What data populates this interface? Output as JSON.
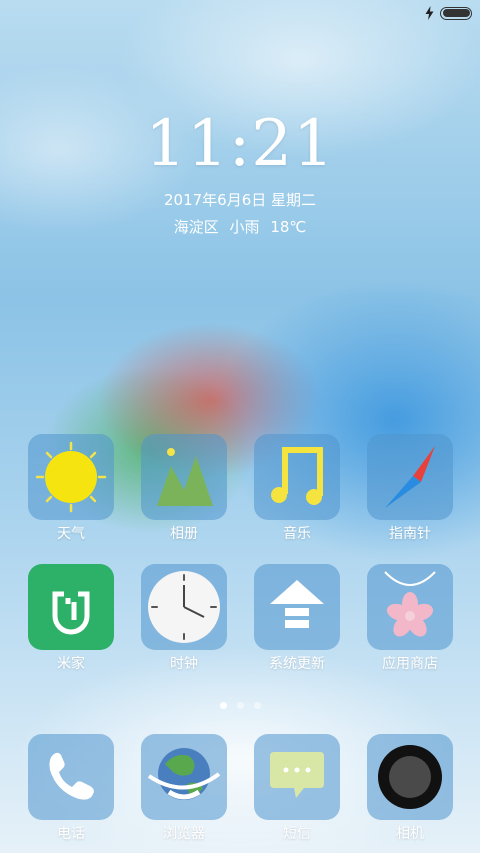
{
  "status_bar": {
    "charging_icon": "bolt-icon",
    "battery_level": 1.0
  },
  "lockscreen": {
    "time": "11:21",
    "date": "2017年6月6日 星期二",
    "location": "海淀区",
    "weather": "小雨",
    "temperature": "18℃"
  },
  "apps": [
    {
      "label": "天气",
      "icon": "sun-icon"
    },
    {
      "label": "相册",
      "icon": "mountain-icon"
    },
    {
      "label": "音乐",
      "icon": "music-note-icon"
    },
    {
      "label": "指南针",
      "icon": "compass-icon"
    },
    {
      "label": "米家",
      "icon": "mijia-icon"
    },
    {
      "label": "时钟",
      "icon": "clock-icon"
    },
    {
      "label": "系统更新",
      "icon": "update-arrow-icon"
    },
    {
      "label": "应用商店",
      "icon": "flower-icon"
    }
  ],
  "page_indicator": {
    "count": 3,
    "active": 1
  },
  "dock": [
    {
      "label": "电话",
      "icon": "phone-icon"
    },
    {
      "label": "浏览器",
      "icon": "globe-icon"
    },
    {
      "label": "短信",
      "icon": "message-icon"
    },
    {
      "label": "相机",
      "icon": "camera-icon"
    }
  ],
  "colors": {
    "sun": "#f6e411",
    "mijia_green": "#2db168",
    "compass_red": "#e8413b",
    "compass_blue": "#2a8ce0",
    "message_bubble": "#d8e6a6"
  }
}
